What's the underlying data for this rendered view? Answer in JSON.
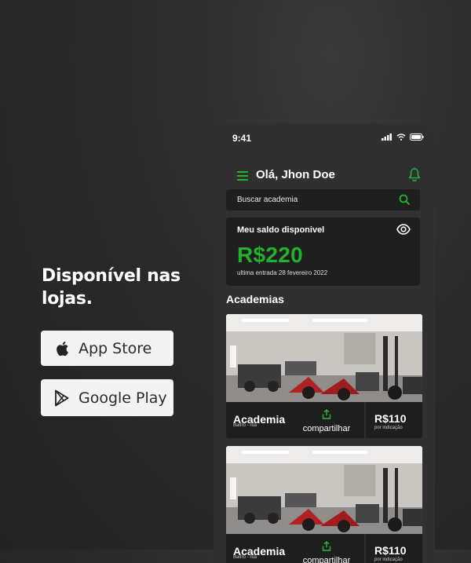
{
  "promo": {
    "headline": "Disponível nas lojas.",
    "app_store_label": "App Store",
    "google_play_label": "Google Play"
  },
  "status_bar": {
    "time": "9:41"
  },
  "header": {
    "greeting": "Olá, Jhon Doe"
  },
  "search": {
    "placeholder": "Buscar academia"
  },
  "balance": {
    "title": "Meu saldo disponivel",
    "amount": "R$220",
    "last_entry": "ultima entrada 28 fevereiro 2022"
  },
  "section_title": "Academias",
  "gyms": [
    {
      "name": "Academia",
      "location": "Bairro - rua",
      "share_label": "compartilhar",
      "price": "R$110",
      "price_note": "por indicação"
    },
    {
      "name": "Academia",
      "location": "Bairro - rua",
      "share_label": "compartilhar",
      "price": "R$110",
      "price_note": "por indicação"
    }
  ],
  "colors": {
    "accent": "#22b12d",
    "background": "#262626",
    "card": "#1f1f1f",
    "phone": "#303030"
  },
  "icons": [
    "apple-icon",
    "google-play-icon",
    "menu-icon",
    "bell-icon",
    "search-icon",
    "eye-icon",
    "share-icon"
  ]
}
